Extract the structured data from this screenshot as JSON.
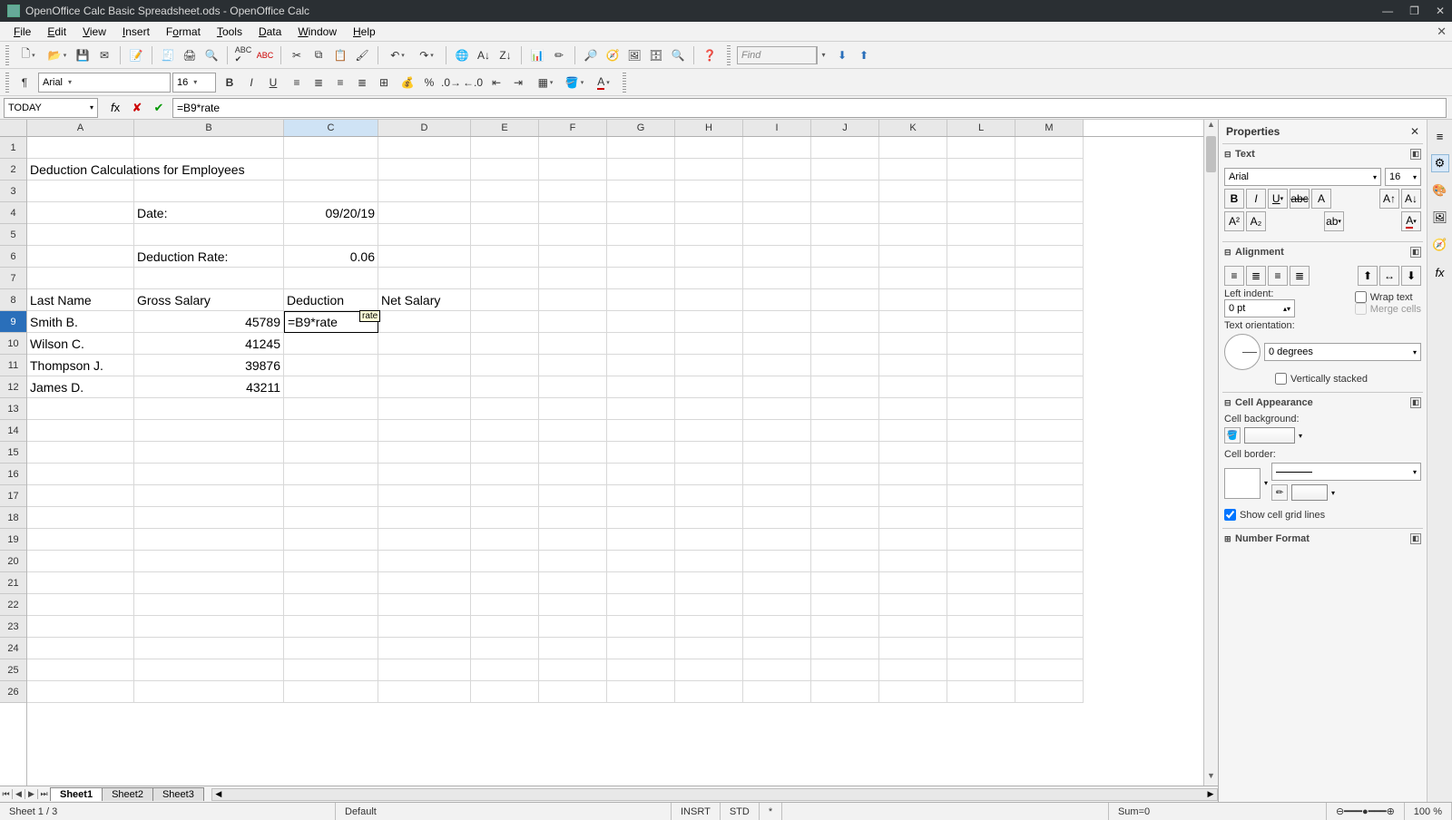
{
  "window": {
    "title": "OpenOffice Calc Basic Spreadsheet.ods - OpenOffice Calc"
  },
  "menu": [
    "File",
    "Edit",
    "View",
    "Insert",
    "Format",
    "Tools",
    "Data",
    "Window",
    "Help"
  ],
  "find_placeholder": "Find",
  "format_toolbar": {
    "font_name": "Arial",
    "font_size": "16"
  },
  "namebox": "TODAY",
  "formula": "=B9*rate",
  "tooltip": "rate",
  "columns": [
    "A",
    "B",
    "C",
    "D",
    "E",
    "F",
    "G",
    "H",
    "I",
    "J",
    "K",
    "L",
    "M"
  ],
  "rows_count": 26,
  "active_cell": {
    "col": "C",
    "row": 9
  },
  "cells": {
    "A2": "Deduction Calculations for Employees",
    "B4": "Date:",
    "C4": "09/20/19",
    "B6": "Deduction Rate:",
    "C6": "0.06",
    "A8": "Last Name",
    "B8": "Gross Salary",
    "C8": "Deduction",
    "D8": "Net Salary",
    "A9": "Smith B.",
    "B9": "45789",
    "C9": "=B9*rate",
    "A10": "Wilson C.",
    "B10": "41245",
    "A11": "Thompson J.",
    "B11": "39876",
    "A12": "James D.",
    "B12": "43211"
  },
  "sheet_tabs": [
    "Sheet1",
    "Sheet2",
    "Sheet3"
  ],
  "active_tab": 0,
  "status": {
    "sheet": "Sheet 1 / 3",
    "style": "Default",
    "insert": "INSRT",
    "std": "STD",
    "modified": "*",
    "sum": "Sum=0",
    "zoom_symbol": "⊖───⊕",
    "zoom": "100 %"
  },
  "sidebar": {
    "title": "Properties",
    "text": {
      "title": "Text",
      "font": "Arial",
      "size": "16"
    },
    "alignment": {
      "title": "Alignment",
      "indent_label": "Left indent:",
      "indent_value": "0 pt",
      "wrap": "Wrap text",
      "merge": "Merge cells",
      "orient_label": "Text orientation:",
      "orient_value": "0 degrees",
      "vstack": "Vertically stacked"
    },
    "appearance": {
      "title": "Cell Appearance",
      "bg_label": "Cell background:",
      "border_label": "Cell border:",
      "gridlines": "Show cell grid lines"
    },
    "numfmt": {
      "title": "Number Format"
    }
  }
}
